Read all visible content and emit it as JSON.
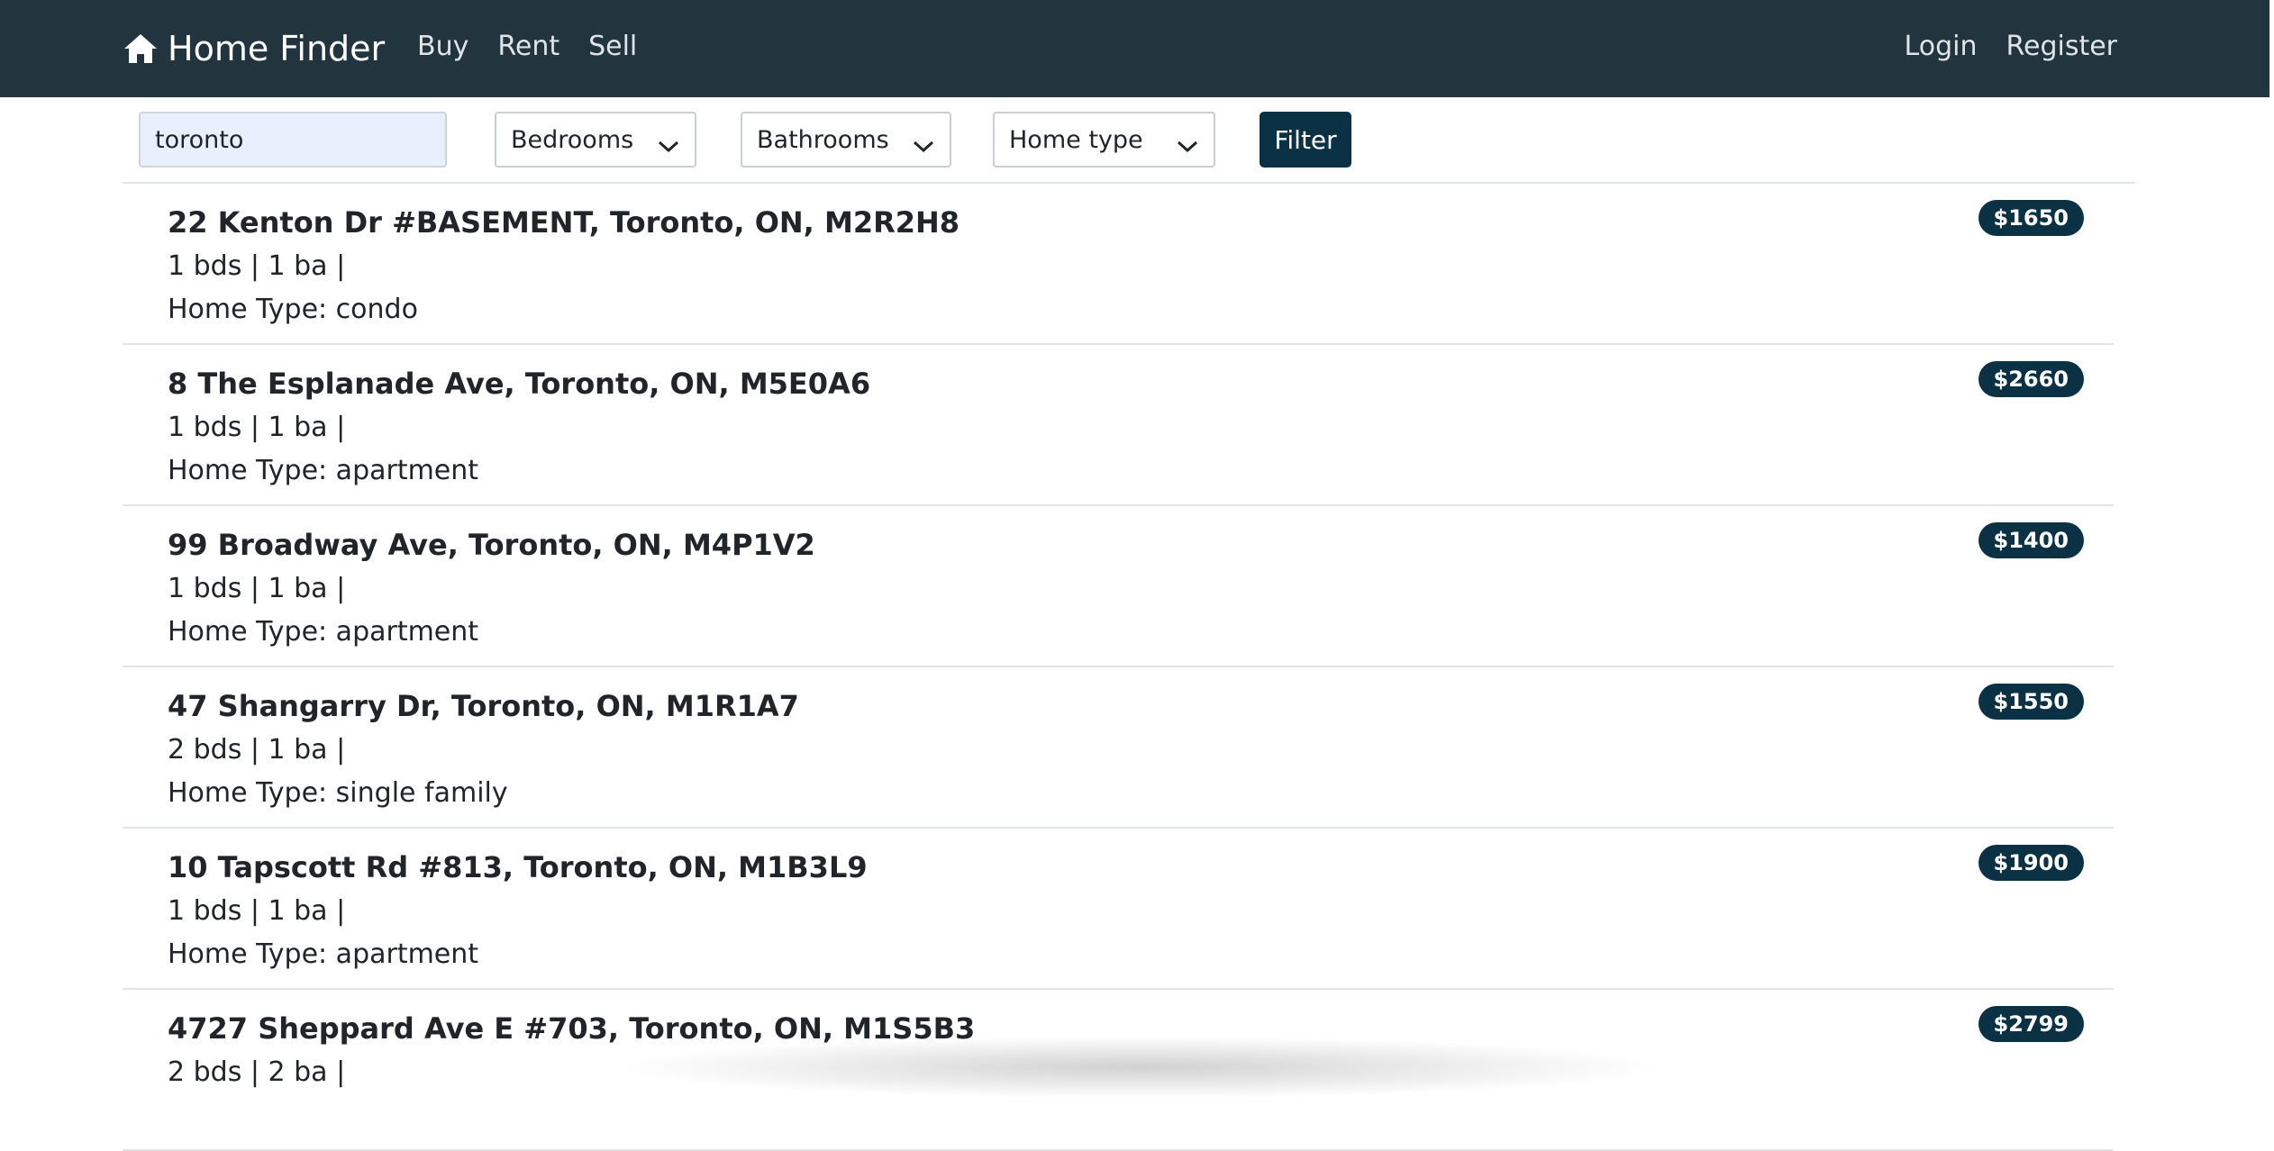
{
  "navbar": {
    "brand": "Home Finder",
    "brand_icon": "home-icon",
    "links": [
      "Buy",
      "Rent",
      "Sell"
    ],
    "auth": {
      "login": "Login",
      "register": "Register"
    }
  },
  "filters": {
    "search_value": "toronto",
    "bedrooms": "Bedrooms",
    "bathrooms": "Bathrooms",
    "home_type": "Home type",
    "filter_button": "Filter"
  },
  "listings": [
    {
      "address": "22 Kenton Dr #BASEMENT, Toronto, ON, M2R2H8",
      "details": "1 bds | 1 ba |",
      "home_type": "Home Type: condo",
      "price": "$1650"
    },
    {
      "address": "8 The Esplanade Ave, Toronto, ON, M5E0A6",
      "details": "1 bds | 1 ba |",
      "home_type": "Home Type: apartment",
      "price": "$2660"
    },
    {
      "address": "99 Broadway Ave, Toronto, ON, M4P1V2",
      "details": "1 bds | 1 ba |",
      "home_type": "Home Type: apartment",
      "price": "$1400"
    },
    {
      "address": "47 Shangarry Dr, Toronto, ON, M1R1A7",
      "details": "2 bds | 1 ba |",
      "home_type": "Home Type: single family",
      "price": "$1550"
    },
    {
      "address": "10 Tapscott Rd #813, Toronto, ON, M1B3L9",
      "details": "1 bds | 1 ba |",
      "home_type": "Home Type: apartment",
      "price": "$1900"
    },
    {
      "address": "4727 Sheppard Ave E #703, Toronto, ON, M1S5B3",
      "details": "2 bds | 2 ba |",
      "home_type": "",
      "price": "$2799"
    }
  ],
  "colors": {
    "navbar_bg": "#22343e",
    "accent": "#0b3145",
    "search_bg": "#e8f0fe"
  }
}
